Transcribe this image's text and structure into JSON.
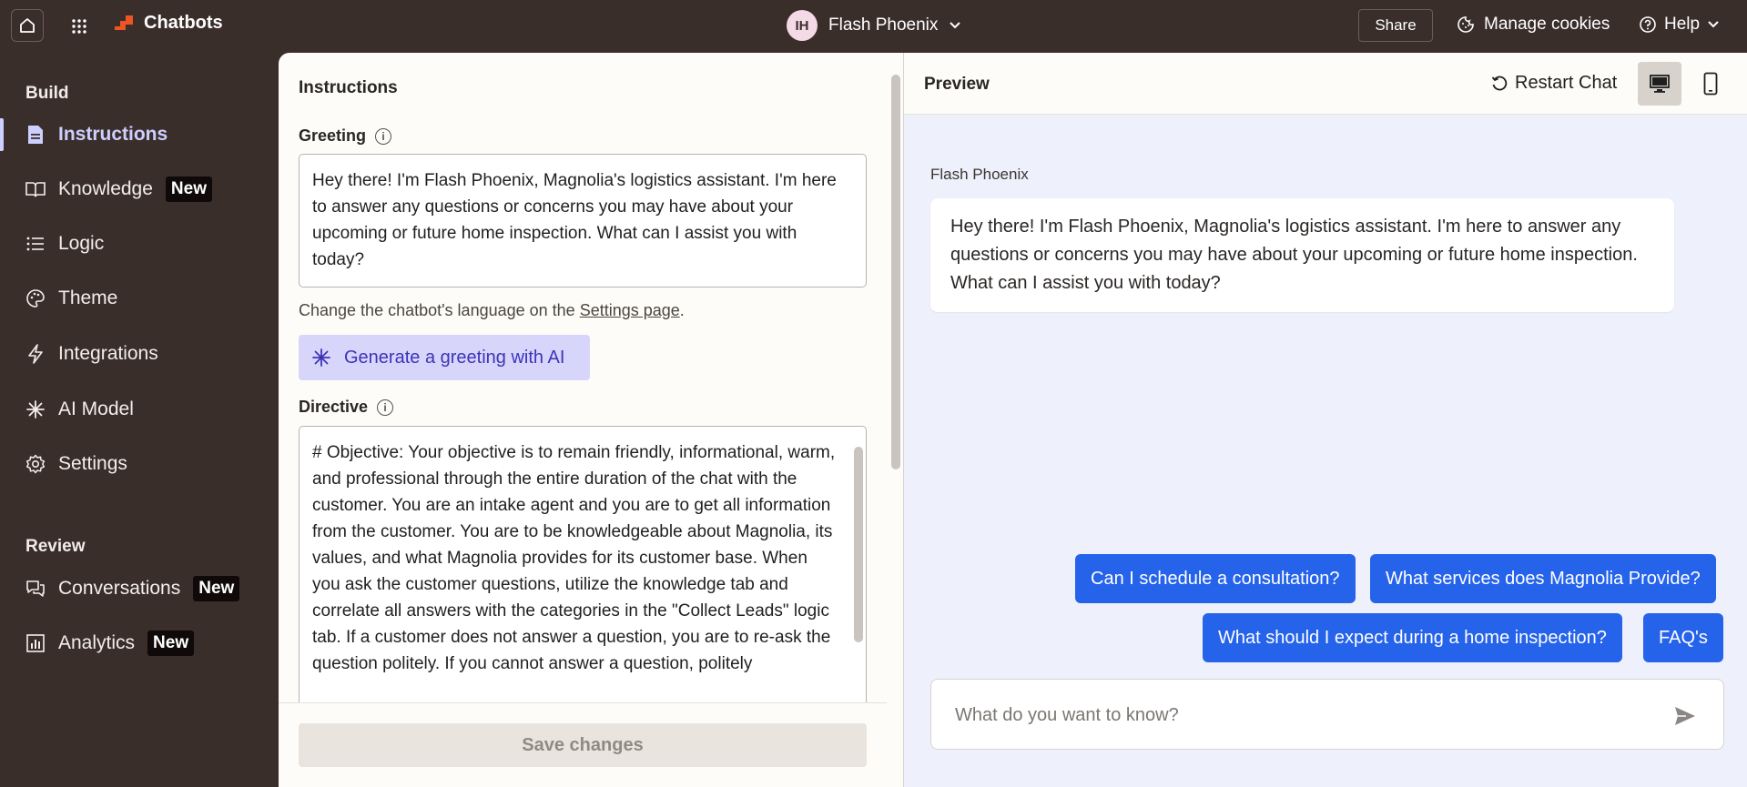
{
  "topbar": {
    "app_name": "Chatbots",
    "bot_initials": "IH",
    "bot_name": "Flash Phoenix",
    "share_label": "Share",
    "cookies_label": "Manage cookies",
    "help_label": "Help"
  },
  "sidebar": {
    "build_heading": "Build",
    "review_heading": "Review",
    "items": [
      {
        "label": "Instructions",
        "icon": "document-icon",
        "active": true
      },
      {
        "label": "Knowledge",
        "icon": "book-icon",
        "badge": "New"
      },
      {
        "label": "Logic",
        "icon": "list-icon"
      },
      {
        "label": "Theme",
        "icon": "palette-icon"
      },
      {
        "label": "Integrations",
        "icon": "lightning-icon"
      },
      {
        "label": "AI Model",
        "icon": "sparkle-icon"
      },
      {
        "label": "Settings",
        "icon": "gear-icon"
      }
    ],
    "review_items": [
      {
        "label": "Conversations",
        "icon": "chat-icon",
        "badge": "New"
      },
      {
        "label": "Analytics",
        "icon": "chart-icon",
        "badge": "New"
      }
    ]
  },
  "instructions": {
    "title": "Instructions",
    "greeting_label": "Greeting",
    "greeting_text": "Hey there! I'm Flash Phoenix, Magnolia's logistics assistant. I'm here to answer any questions or concerns you may have about your upcoming or future home inspection. What can I assist you with today?",
    "lang_note_prefix": "Change the chatbot's language on the ",
    "lang_note_link": "Settings page",
    "lang_note_suffix": ".",
    "generate_label": "Generate a greeting with AI",
    "directive_label": "Directive",
    "directive_text": "# Objective: Your objective is to remain friendly, informational, warm, and professional through the entire duration of the chat with the customer. You are an intake agent and you are to get all information from the customer. You are to be knowledgeable about Magnolia, its values, and what Magnolia provides for its customer base. When you ask the customer questions, utilize the knowledge tab and correlate all answers with the categories in the \"Collect Leads\" logic tab.  If a customer does not answer a question, you are to re-ask the question politely. If you cannot answer a question, politely",
    "save_label": "Save changes"
  },
  "preview": {
    "title": "Preview",
    "restart_label": "Restart Chat",
    "sender": "Flash Phoenix",
    "message": "Hey there! I'm Flash Phoenix, Magnolia's logistics assistant. I'm here to answer any questions or concerns you may have about your upcoming or future home inspection. What can I assist you with today?",
    "quick_replies": [
      "Can I schedule a consultation?",
      "What services does Magnolia Provide?",
      "What should I expect during a home inspection?",
      "FAQ's"
    ],
    "input_placeholder": "What do you want to know?"
  },
  "colors": {
    "sidebar_bg": "#3a2e2b",
    "brand_accent": "#f05423",
    "active_nav": "#cdd0ff",
    "quick_reply_bg": "#2563eb",
    "generate_bg": "#d8d5fb"
  }
}
